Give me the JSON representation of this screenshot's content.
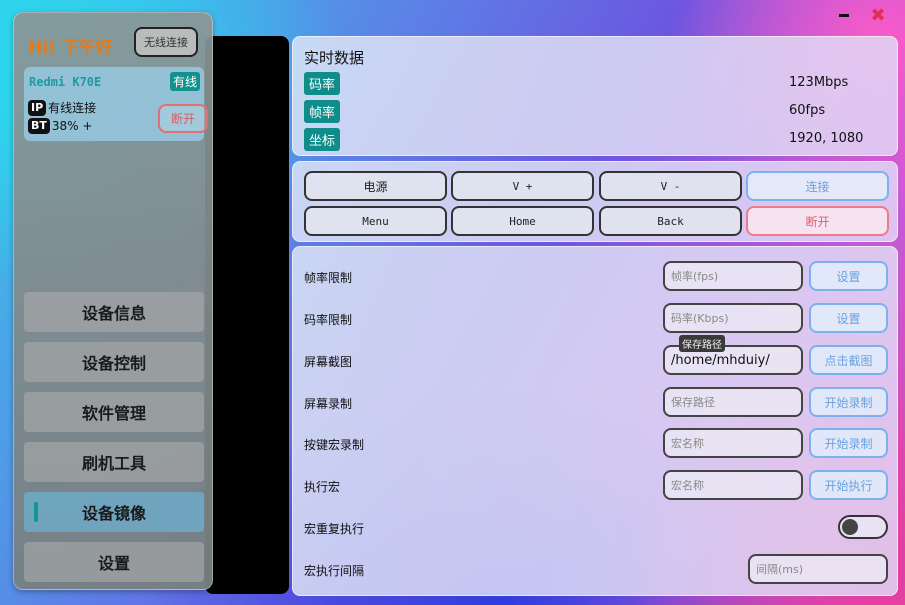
{
  "window": {
    "title": ""
  },
  "sidebar": {
    "greeting": "Hi! 下午好",
    "wireless_button": "无线连接",
    "device": {
      "name": "Redmi K70E",
      "connection_type": "有线",
      "ip_tag": "IP",
      "ip_value": "有线连接",
      "bt_tag": "BT",
      "bt_value": "38% +",
      "disconnect_label": "断开"
    },
    "nav": [
      {
        "label": "设备信息"
      },
      {
        "label": "设备控制"
      },
      {
        "label": "软件管理"
      },
      {
        "label": "刷机工具"
      },
      {
        "label": "设备镜像",
        "active": true
      },
      {
        "label": "设置"
      }
    ]
  },
  "realtime": {
    "title": "实时数据",
    "stats": [
      {
        "label": "码率",
        "value": "123Mbps"
      },
      {
        "label": "帧率",
        "value": "60fps"
      },
      {
        "label": "坐标",
        "value": "1920, 1080"
      }
    ]
  },
  "controls": {
    "row1": [
      "电源",
      "V +",
      "V -",
      "连接"
    ],
    "row2": [
      "Menu",
      "Home",
      "Back",
      "断开"
    ]
  },
  "settings": {
    "fps_limit": {
      "label": "帧率限制",
      "placeholder": "帧率(fps)",
      "button": "设置"
    },
    "bitrate_limit": {
      "label": "码率限制",
      "placeholder": "码率(Kbps)",
      "button": "设置"
    },
    "screenshot": {
      "label": "屏幕截图",
      "value": "/home/mhduiy/",
      "tooltip": "保存路径",
      "button": "点击截图"
    },
    "record": {
      "label": "屏幕录制",
      "placeholder": "保存路径",
      "button": "开始录制"
    },
    "macro_record": {
      "label": "按键宏录制",
      "placeholder": "宏名称",
      "button": "开始录制"
    },
    "macro_run": {
      "label": "执行宏",
      "placeholder": "宏名称",
      "button": "开始执行"
    },
    "macro_repeat": {
      "label": "宏重复执行",
      "enabled": false
    },
    "macro_interval": {
      "label": "宏执行间隔",
      "placeholder": "间隔(ms)"
    }
  },
  "colors": {
    "accent_teal": "#0f8d8a",
    "greeting_orange": "#e27a1e",
    "button_blue": "#6aa2e0",
    "button_red": "#e0606e"
  }
}
